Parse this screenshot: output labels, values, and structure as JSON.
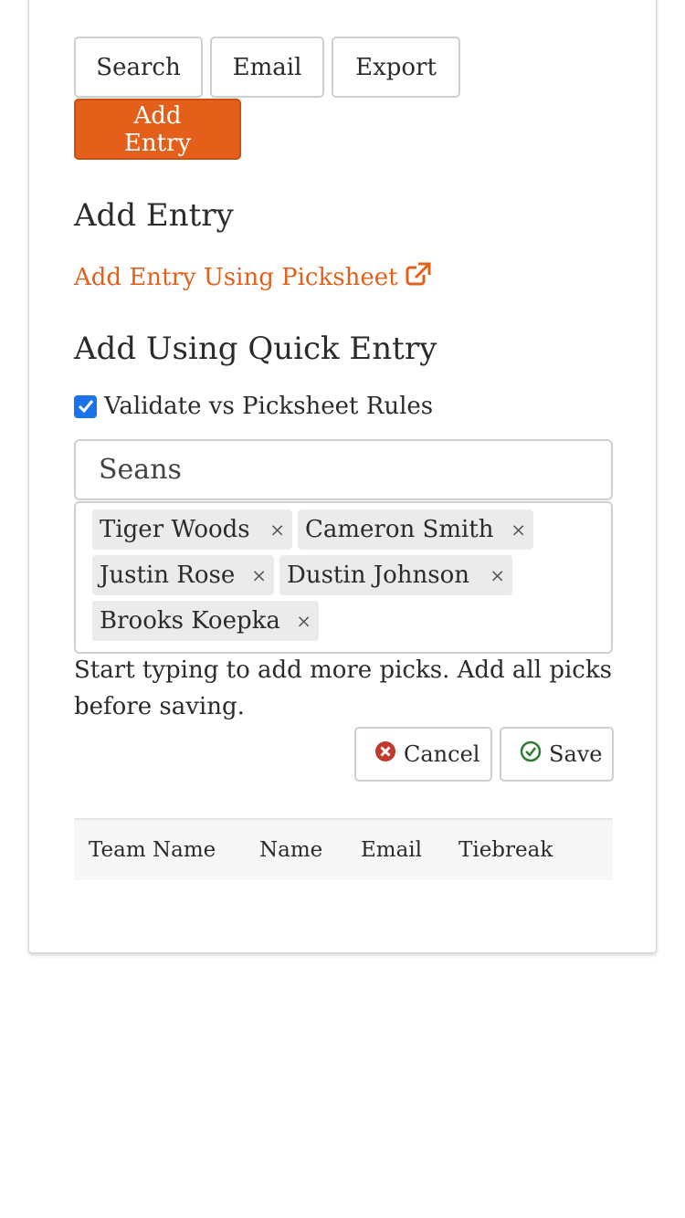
{
  "toolbar": {
    "search_label": "Search",
    "email_label": "Email",
    "export_label": "Export",
    "add_entry_label": "Add Entry"
  },
  "add_entry": {
    "heading": "Add Entry",
    "picksheet_link": "Add Entry Using Picksheet",
    "link_icon": "external-link-icon"
  },
  "quick_entry": {
    "heading": "Add Using Quick Entry",
    "validate_label": "Validate vs Picksheet Rules",
    "validate_checked": true,
    "team_value": "Seans",
    "picks": [
      {
        "name": "Tiger Woods"
      },
      {
        "name": "Cameron Smith"
      },
      {
        "name": "Justin Rose"
      },
      {
        "name": "Dustin Johnson"
      },
      {
        "name": "Brooks Koepka"
      }
    ],
    "remove_glyph": "×",
    "help_text": "Start typing to add more picks. Add all picks before saving.",
    "cancel_label": "Cancel",
    "save_label": "Save"
  },
  "table": {
    "columns": [
      "Team Name",
      "Name",
      "Email",
      "Tiebreak"
    ]
  },
  "colors": {
    "accent": "#e4601a",
    "cancel_icon": "#c0392b",
    "save_icon": "#2e7d32",
    "checkbox": "#1a73e8"
  }
}
